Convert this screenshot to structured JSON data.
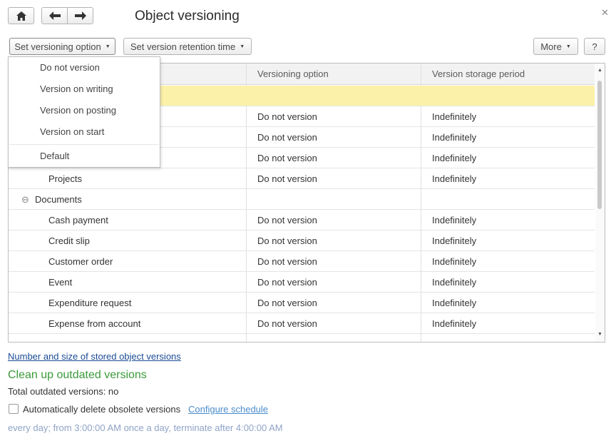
{
  "window": {
    "title": "Object versioning"
  },
  "toolbar": {
    "home_icon": "home-icon",
    "back_icon": "arrow-left-icon",
    "forward_icon": "arrow-right-icon",
    "close_icon": "✕"
  },
  "command_bar": {
    "set_versioning_option": "Set versioning option",
    "set_retention_time": "Set version retention time",
    "more": "More",
    "help": "?"
  },
  "dropdown": {
    "items": [
      "Do not version",
      "Version on writing",
      "Version on posting",
      "Version on start",
      "Default"
    ]
  },
  "grid": {
    "columns": [
      "Versioning option",
      "Version storage period"
    ],
    "rows": [
      {
        "name": "",
        "option": "",
        "period": "",
        "selected": true
      },
      {
        "name": "",
        "option": "Do not version",
        "period": "Indefinitely"
      },
      {
        "name": "",
        "option": "Do not version",
        "period": "Indefinitely"
      },
      {
        "name": "",
        "option": "Do not version",
        "period": "Indefinitely"
      },
      {
        "name": "Projects",
        "option": "Do not version",
        "period": "Indefinitely"
      },
      {
        "name": "Documents",
        "option": "",
        "period": "",
        "group": true,
        "expander": "⊖"
      },
      {
        "name": "Cash payment",
        "option": "Do not version",
        "period": "Indefinitely"
      },
      {
        "name": "Credit slip",
        "option": "Do not version",
        "period": "Indefinitely"
      },
      {
        "name": "Customer order",
        "option": "Do not version",
        "period": "Indefinitely"
      },
      {
        "name": "Event",
        "option": "Do not version",
        "period": "Indefinitely"
      },
      {
        "name": "Expenditure request",
        "option": "Do not version",
        "period": "Indefinitely"
      },
      {
        "name": "Expense from account",
        "option": "Do not version",
        "period": "Indefinitely"
      }
    ]
  },
  "footer": {
    "stats_link": "Number and size of stored object versions",
    "cleanup_title": "Clean up outdated versions",
    "outdated_label": "Total outdated versions: no",
    "auto_delete_label": "Automatically delete obsolete versions",
    "auto_delete_checked": false,
    "configure_schedule": "Configure schedule",
    "schedule_text": "every  day; from 3:00:00 AM once a day, terminate after 4:00:00 AM"
  }
}
